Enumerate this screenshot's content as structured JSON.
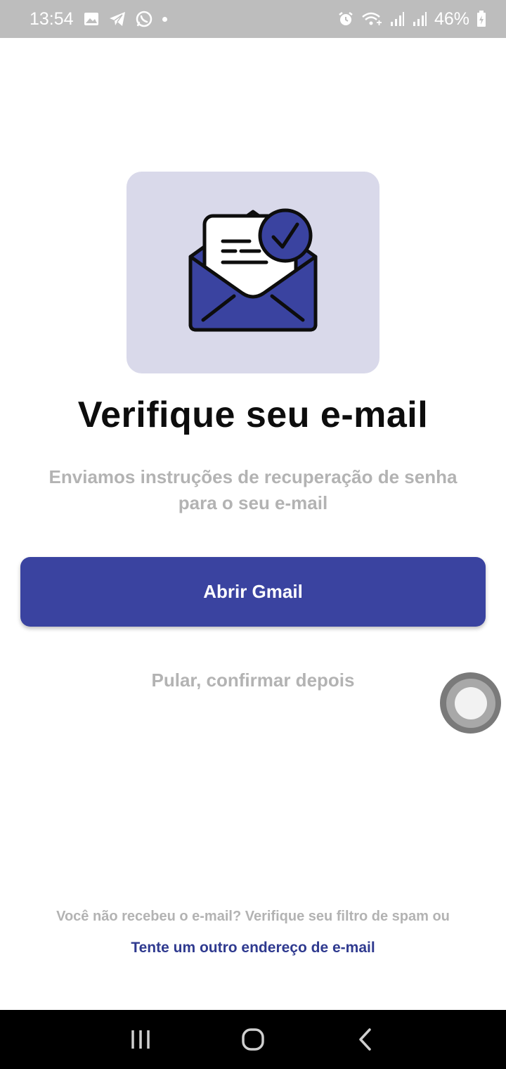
{
  "status_bar": {
    "time": "13:54",
    "battery": "46%",
    "left_icons": [
      "image-icon",
      "telegram-icon",
      "whatsapp-icon",
      "dot-icon"
    ],
    "right_icons": [
      "alarm-icon",
      "wifi-icon",
      "signal-icon",
      "signal-icon",
      "battery-icon"
    ]
  },
  "main": {
    "title": "Verifique seu e-mail",
    "subtitle": "Enviamos instruções de recuperação de senha para o seu e-mail",
    "open_gmail_label": "Abrir Gmail",
    "skip_label": "Pular, confirmar depois",
    "hint": "Você não recebeu o e-mail? Verifique seu filtro de spam ou",
    "alt_link": "Tente um outro endereço de e-mail"
  },
  "colors": {
    "accent": "#3a43a0",
    "hero_bg": "#d9d9ea",
    "muted_text": "#b3b3b3",
    "link": "#2f3a8f"
  },
  "nav": {
    "icons": [
      "recent-apps-icon",
      "home-icon",
      "back-icon"
    ]
  }
}
